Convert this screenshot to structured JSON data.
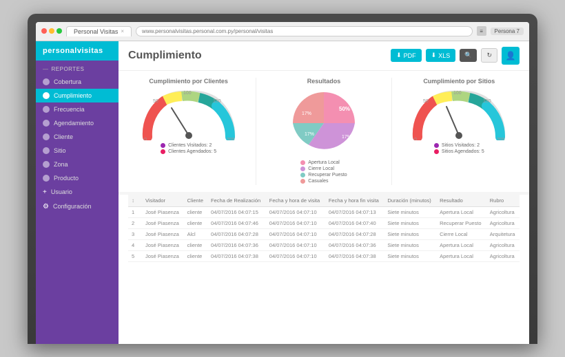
{
  "browser": {
    "tab_label": "Personal Visitas",
    "address": "www.personalvisitas.personal.com.py/personal/visitas",
    "persona_label": "Persona 7"
  },
  "sidebar": {
    "brand": "personalvisitas",
    "section_title": "Reportes",
    "items": [
      {
        "label": "Cobertura",
        "active": false,
        "icon": "person-icon"
      },
      {
        "label": "Cumplimiento",
        "active": true,
        "icon": "location-icon"
      },
      {
        "label": "Frecuencia",
        "active": false,
        "icon": "wifi-icon"
      },
      {
        "label": "Agendamiento",
        "active": false,
        "icon": "calendar-icon"
      },
      {
        "label": "Cliente",
        "active": false,
        "icon": "person2-icon"
      },
      {
        "label": "Sitio",
        "active": false,
        "icon": "location2-icon"
      },
      {
        "label": "Zona",
        "active": false,
        "icon": "map-icon"
      },
      {
        "label": "Producto",
        "active": false,
        "icon": "box-icon"
      },
      {
        "label": "Usuario",
        "active": false,
        "icon": "user-icon"
      },
      {
        "label": "Configuración",
        "active": false,
        "icon": "gear-icon"
      }
    ]
  },
  "header": {
    "title": "Cumplimiento",
    "btn_pdf": "PDF",
    "btn_xls": "XLS"
  },
  "charts": {
    "left": {
      "title": "Cumplimiento por Clientes",
      "legend": [
        {
          "label": "Clientes Visitados: 2",
          "color": "#9c27b0"
        },
        {
          "label": "Clientes Agendados: 5",
          "color": "#e91e63"
        }
      ]
    },
    "center": {
      "title": "Resultados",
      "segments": [
        {
          "label": "Apertura Local",
          "value": 50,
          "color": "#f48fb1"
        },
        {
          "label": "Cierre Local",
          "value": 17,
          "color": "#ce93d8"
        },
        {
          "label": "Recuperar Puesto",
          "value": 17,
          "color": "#80cbc4"
        },
        {
          "label": "Casuales",
          "value": 17,
          "color": "#ef9a9a"
        }
      ],
      "legend": [
        {
          "label": "Apertura Local",
          "color": "#f48fb1"
        },
        {
          "label": "Cierre Local",
          "color": "#ce93d8"
        },
        {
          "label": "Recuperar Puesto",
          "color": "#80cbc4"
        },
        {
          "label": "Casuales",
          "color": "#ef9a9a"
        }
      ]
    },
    "right": {
      "title": "Cumplimiento por Sitios",
      "legend": [
        {
          "label": "Sitios Visitados: 2",
          "color": "#9c27b0"
        },
        {
          "label": "Sitios Agendados: 5",
          "color": "#e91e63"
        }
      ]
    }
  },
  "table": {
    "columns": [
      "",
      "Visitador",
      "Cliente",
      "Fecha de Realización",
      "Fecha y hora de visita",
      "Fecha y hora fin visita",
      "Duración (minutos)",
      "Resultado",
      "Rubro"
    ],
    "rows": [
      [
        "1",
        "José Piasenza",
        "cliente",
        "04/07/2016 04:07:15",
        "04/07/2016 04:07:10",
        "04/07/2016 04:07:13",
        "Siete minutos",
        "Apertura Local",
        "Agricoltura"
      ],
      [
        "2",
        "José Piasenza",
        "cliente",
        "04/07/2016 04:07:46",
        "04/07/2016 04:07:10",
        "04/07/2016 04:07:40",
        "Siete minutos",
        "Recuperar Puesto",
        "Agricoltura"
      ],
      [
        "3",
        "José Piasenza",
        "Alcl",
        "04/07/2016 04:07:28",
        "04/07/2016 04:07:10",
        "04/07/2016 04:07:28",
        "Siete minutos",
        "Cierre Local",
        "Arquitetura"
      ],
      [
        "4",
        "José Piasenza",
        "cliente",
        "04/07/2016 04:07:36",
        "04/07/2016 04:07:10",
        "04/07/2016 04:07:36",
        "Siete minutos",
        "Apertura Local",
        "Agricoltura"
      ],
      [
        "5",
        "José Piasenza",
        "cliente",
        "04/07/2016 04:07:38",
        "04/07/2016 04:07:10",
        "04/07/2016 04:07:38",
        "Siete minutos",
        "Apertura Local",
        "Agricoltura"
      ]
    ]
  }
}
